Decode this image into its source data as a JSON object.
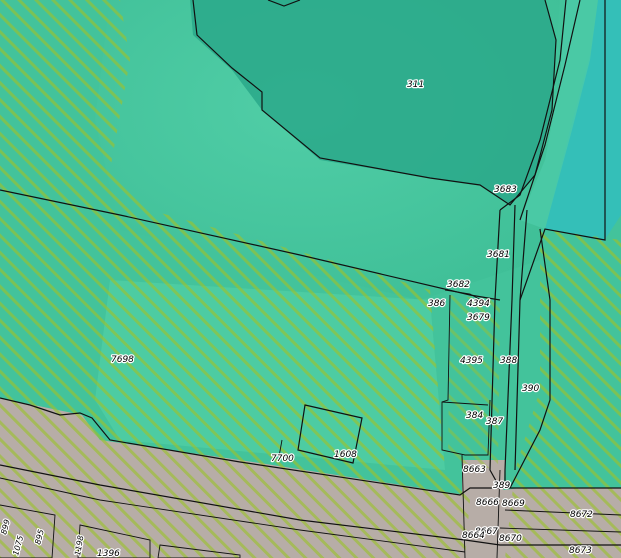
{
  "map": {
    "colors": {
      "base": "#43c39b",
      "water": "#2aa88a",
      "forest": "#4dcfa6",
      "meadow": "#55d3a8",
      "channel": "#34bfb8",
      "road": "#b7ada7",
      "hatch": "#9bc22e",
      "boundary": "#111111"
    },
    "parcels": {
      "p311": "311",
      "p3683": "3683",
      "p3681": "3681",
      "p3682": "3682",
      "p386": "386",
      "p4394": "4394",
      "p3679": "3679",
      "p7698": "7698",
      "p4395": "4395",
      "p388": "388",
      "p390": "390",
      "p384": "384",
      "p387": "387",
      "p1608": "1608",
      "p7700": "7700",
      "p8663": "8663",
      "p389": "389",
      "p8666": "8666",
      "p8669": "8669",
      "p8672": "8672",
      "p8667": "8667",
      "p8664": "8664",
      "p8670": "8670",
      "p8673": "8673",
      "p1396": "1396",
      "p1198": "1198",
      "p1075": "1075",
      "p895": "895",
      "p899": "899"
    }
  }
}
